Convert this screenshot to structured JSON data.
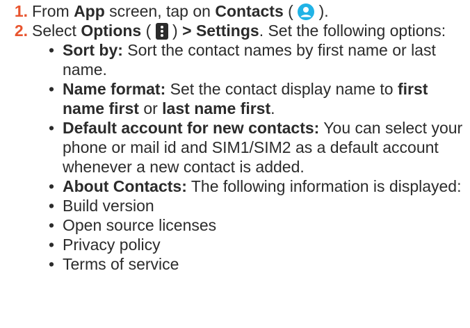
{
  "steps": [
    {
      "number": "1",
      "text_a": "From ",
      "bold_a": "App",
      "text_b": " screen, tap on ",
      "bold_b": "Contacts",
      "text_c": " ( ",
      "text_d": " ).",
      "icon": "contacts-icon"
    },
    {
      "number": "2",
      "text_a": "Select ",
      "bold_a": "Options",
      "text_b": " ( ",
      "text_c": " ) ",
      "bold_b": "> Settings",
      "text_d": ". Set the following options:",
      "icon": "options-menu-icon"
    }
  ],
  "options": [
    {
      "label": "Sort by:",
      "desc": " Sort the contact names by first name or last name."
    },
    {
      "label": "Name format:",
      "desc": " Set the contact display name to ",
      "bold1": "first name first",
      "mid": " or ",
      "bold2": "last name first",
      "end": "."
    },
    {
      "label": "Default account for new contacts:",
      "desc": " You can select your phone or mail id and SIM1/SIM2 as a default account whenever a new contact is added."
    },
    {
      "label": "About Contacts:",
      "desc": " The following information is displayed:"
    }
  ],
  "about_items": [
    "Build version",
    "Open source licenses",
    "Privacy policy",
    "Terms of service"
  ],
  "colors": {
    "step_number": "#e8542e",
    "contacts_icon": "#21b3e6",
    "text": "#2b2b2b"
  }
}
